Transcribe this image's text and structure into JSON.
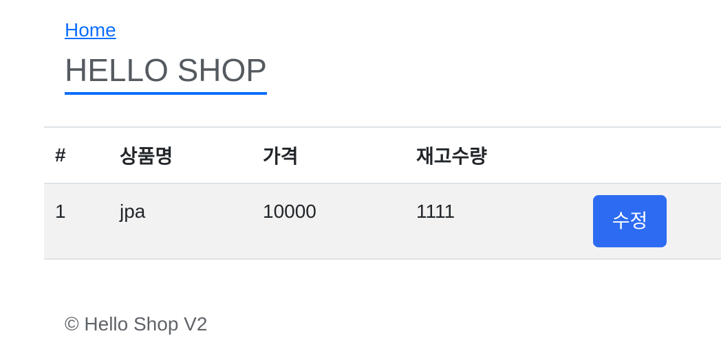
{
  "header": {
    "home_link": "Home",
    "title": "HELLO SHOP"
  },
  "table": {
    "columns": [
      "#",
      "상품명",
      "가격",
      "재고수량",
      ""
    ],
    "rows": [
      {
        "id": "1",
        "name": "jpa",
        "price": "10000",
        "stock": "1111",
        "action_label": "수정"
      }
    ]
  },
  "footer": {
    "text": "© Hello Shop V2"
  },
  "colors": {
    "accent": "#0d6efd",
    "button": "#2d6cf2",
    "row_bg": "#f2f2f2"
  }
}
